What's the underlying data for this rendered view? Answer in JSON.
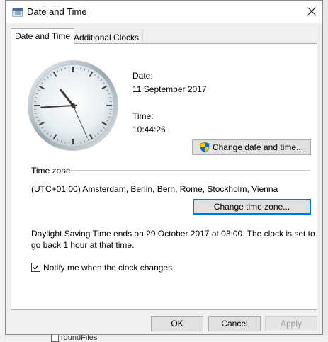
{
  "window": {
    "title": "Date and Time"
  },
  "tabs": [
    {
      "label": "Date and Time",
      "active": true
    },
    {
      "label": "Additional Clocks",
      "active": false
    }
  ],
  "date": {
    "label": "Date:",
    "value": "11 September 2017"
  },
  "time": {
    "label": "Time:",
    "value": "10:44:26"
  },
  "clock": {
    "hours": 10,
    "minutes": 44,
    "seconds": 26
  },
  "buttons": {
    "change_date_time": "Change date and time...",
    "change_time_zone": "Change time zone...",
    "ok": "OK",
    "cancel": "Cancel",
    "apply": "Apply"
  },
  "timezone": {
    "section_label": "Time zone",
    "value": "(UTC+01:00) Amsterdam, Berlin, Bern, Rome, Stockholm, Vienna"
  },
  "dst": {
    "line1": "Daylight Saving Time ends on 29 October 2017 at 03:00. The clock is set to",
    "line2": "go back 1 hour at that time."
  },
  "notify": {
    "label": "Notify me when the clock changes",
    "checked": true
  },
  "background": {
    "peek_label": "roundFiles"
  },
  "colors": {
    "accent": "#0078d7",
    "dialog_bg": "#f0f0f0",
    "panel_bg": "#ffffff"
  },
  "icons": {
    "title": "clock-calendar-icon",
    "close": "close-icon",
    "shield": "uac-shield-icon",
    "check": "checkmark-icon"
  }
}
